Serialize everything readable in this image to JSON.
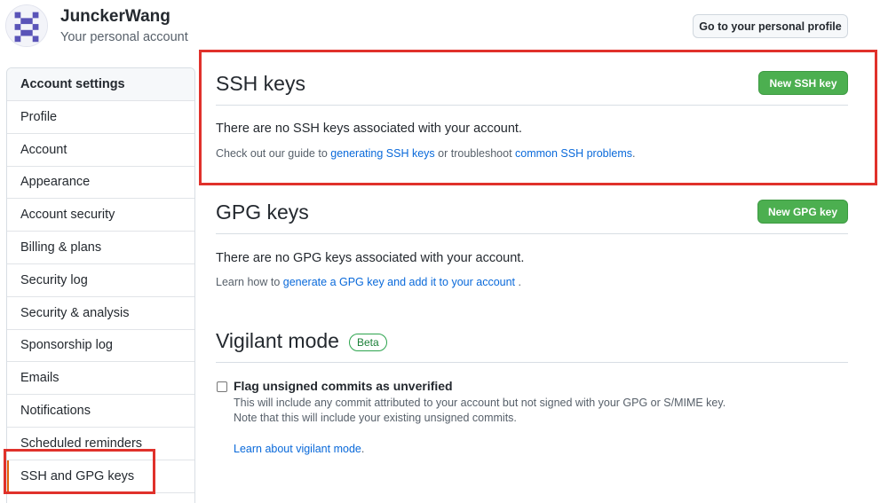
{
  "user": {
    "name": "JunckerWang",
    "subtitle": "Your personal account",
    "profile_button": "Go to your personal profile"
  },
  "sidebar": {
    "heading": "Account settings",
    "items": [
      {
        "label": "Profile"
      },
      {
        "label": "Account"
      },
      {
        "label": "Appearance"
      },
      {
        "label": "Account security"
      },
      {
        "label": "Billing & plans"
      },
      {
        "label": "Security log"
      },
      {
        "label": "Security & analysis"
      },
      {
        "label": "Sponsorship log"
      },
      {
        "label": "Emails"
      },
      {
        "label": "Notifications"
      },
      {
        "label": "Scheduled reminders"
      },
      {
        "label": "SSH and GPG keys"
      }
    ],
    "active": "SSH and GPG keys"
  },
  "ssh": {
    "title": "SSH keys",
    "new_button": "New SSH key",
    "empty_text": "There are no SSH keys associated with your account.",
    "help_prefix": "Check out our guide to ",
    "help_link1": "generating SSH keys",
    "help_middle": " or troubleshoot ",
    "help_link2": "common SSH problems",
    "help_suffix": "."
  },
  "gpg": {
    "title": "GPG keys",
    "new_button": "New GPG key",
    "empty_text": "There are no GPG keys associated with your account.",
    "help_prefix": "Learn how to ",
    "help_link": "generate a GPG key and add it to your account",
    "help_suffix": " ."
  },
  "vigilant": {
    "title": "Vigilant mode",
    "badge": "Beta",
    "checkbox_label": "Flag unsigned commits as unverified",
    "description_line1": "This will include any commit attributed to your account but not signed with your GPG or S/MIME key.",
    "description_line2": "Note that this will include your existing unsigned commits.",
    "learn_link": "Learn about vigilant mode",
    "learn_suffix": "."
  },
  "colors": {
    "accent_green": "#4caf50",
    "link_blue": "#0969da",
    "annotation_red": "#e0312b"
  }
}
